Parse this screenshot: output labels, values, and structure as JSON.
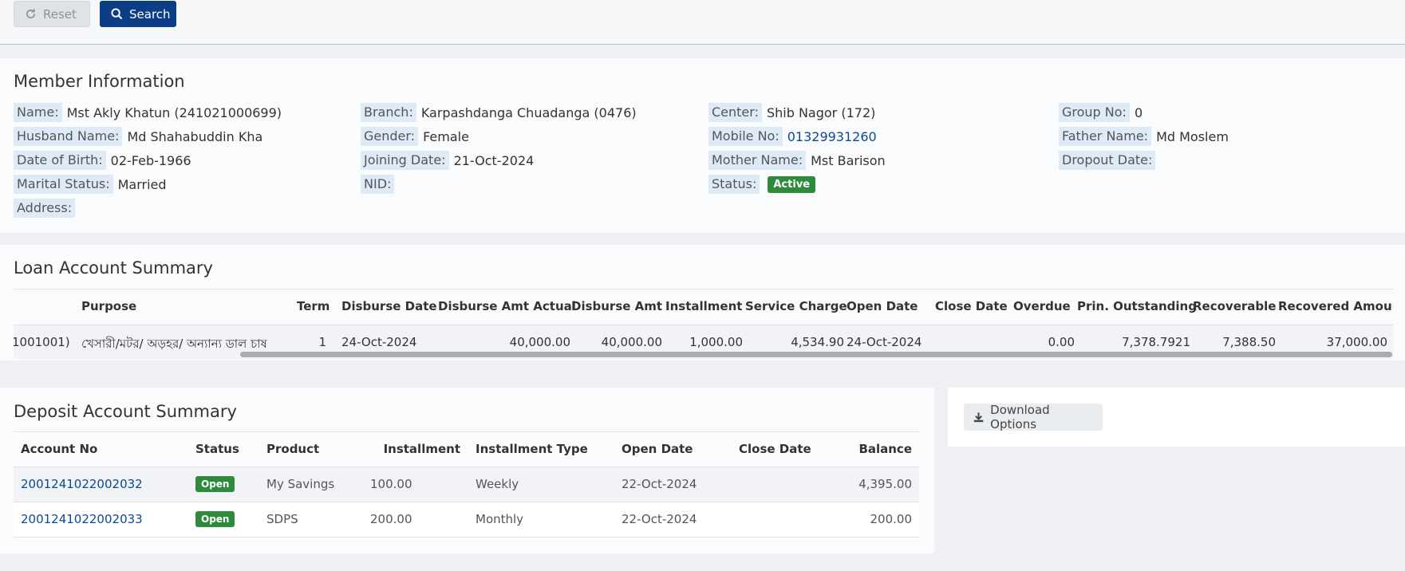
{
  "toolbar": {
    "reset_label": "Reset",
    "search_label": "Search"
  },
  "member": {
    "title": "Member Information",
    "fields": {
      "name": {
        "label": "Name:",
        "value": "Mst Akly Khatun (241021000699)"
      },
      "husband": {
        "label": "Husband Name:",
        "value": "Md Shahabuddin Kha"
      },
      "dob": {
        "label": "Date of Birth:",
        "value": "02-Feb-1966"
      },
      "marital": {
        "label": "Marital Status:",
        "value": "Married"
      },
      "address": {
        "label": "Address:",
        "value": ""
      },
      "branch": {
        "label": "Branch:",
        "value": "Karpashdanga Chuadanga (0476)"
      },
      "gender": {
        "label": "Gender:",
        "value": "Female"
      },
      "joining": {
        "label": "Joining Date:",
        "value": "21-Oct-2024"
      },
      "nid": {
        "label": "NID:",
        "value": ""
      },
      "center": {
        "label": "Center:",
        "value": "Shib Nagor (172)"
      },
      "mobile": {
        "label": "Mobile No:",
        "value": "01329931260"
      },
      "mother": {
        "label": "Mother Name:",
        "value": "Mst Barison"
      },
      "status": {
        "label": "Status:",
        "value": "Active"
      },
      "group": {
        "label": "Group No:",
        "value": "0"
      },
      "father": {
        "label": "Father Name:",
        "value": "Md Moslem"
      },
      "dropout": {
        "label": "Dropout Date:",
        "value": ""
      }
    }
  },
  "loan": {
    "title": "Loan Account Summary",
    "headers": {
      "purpose": "Purpose",
      "term": "Term",
      "disburse_date": "Disburse Date",
      "disburse_amt_actual": "Disburse Amt Actual",
      "disburse_amt": "Disburse Amt",
      "installment": "Installment",
      "service_charge": "Service Charge",
      "open_date": "Open Date",
      "close_date": "Close Date",
      "overdue": "Overdue",
      "prin_outstanding": "Prin. Outstanding",
      "recoverable": "Recoverable",
      "recovered_amount": "Recovered Amount"
    },
    "rows": [
      {
        "account": "1001001)",
        "purpose": "খেসারী/মটর/ অড়হর/ অন্যান্য ডাল চাষ",
        "term": "1",
        "disburse_date": "24-Oct-2024",
        "disburse_amt_actual": "40,000.00",
        "disburse_amt": "40,000.00",
        "installment": "1,000.00",
        "service_charge": "4,534.90",
        "open_date": "24-Oct-2024",
        "close_date": "",
        "overdue": "0.00",
        "prin_outstanding": "7,378.7921",
        "recoverable": "7,388.50",
        "recovered_amount": "37,000.00"
      }
    ]
  },
  "deposit": {
    "title": "Deposit Account Summary",
    "headers": {
      "account_no": "Account No",
      "status": "Status",
      "product": "Product",
      "installment": "Installment",
      "installment_type": "Installment Type",
      "open_date": "Open Date",
      "close_date": "Close Date",
      "balance": "Balance"
    },
    "rows": [
      {
        "account_no": "2001241022002032",
        "status": "Open",
        "product": "My Savings",
        "installment": "100.00",
        "installment_type": "Weekly",
        "open_date": "22-Oct-2024",
        "close_date": "",
        "balance": "4,395.00"
      },
      {
        "account_no": "2001241022002033",
        "status": "Open",
        "product": "SDPS",
        "installment": "200.00",
        "installment_type": "Monthly",
        "open_date": "22-Oct-2024",
        "close_date": "",
        "balance": "200.00"
      }
    ]
  },
  "download": {
    "label": "Download Options"
  },
  "colors": {
    "primary": "#0b3e86",
    "success": "#2e8b3c",
    "label_bg": "#deebf7",
    "link": "#0b4a8f"
  },
  "icons": {
    "reset": "refresh-icon",
    "search": "search-icon",
    "download": "download-icon"
  }
}
